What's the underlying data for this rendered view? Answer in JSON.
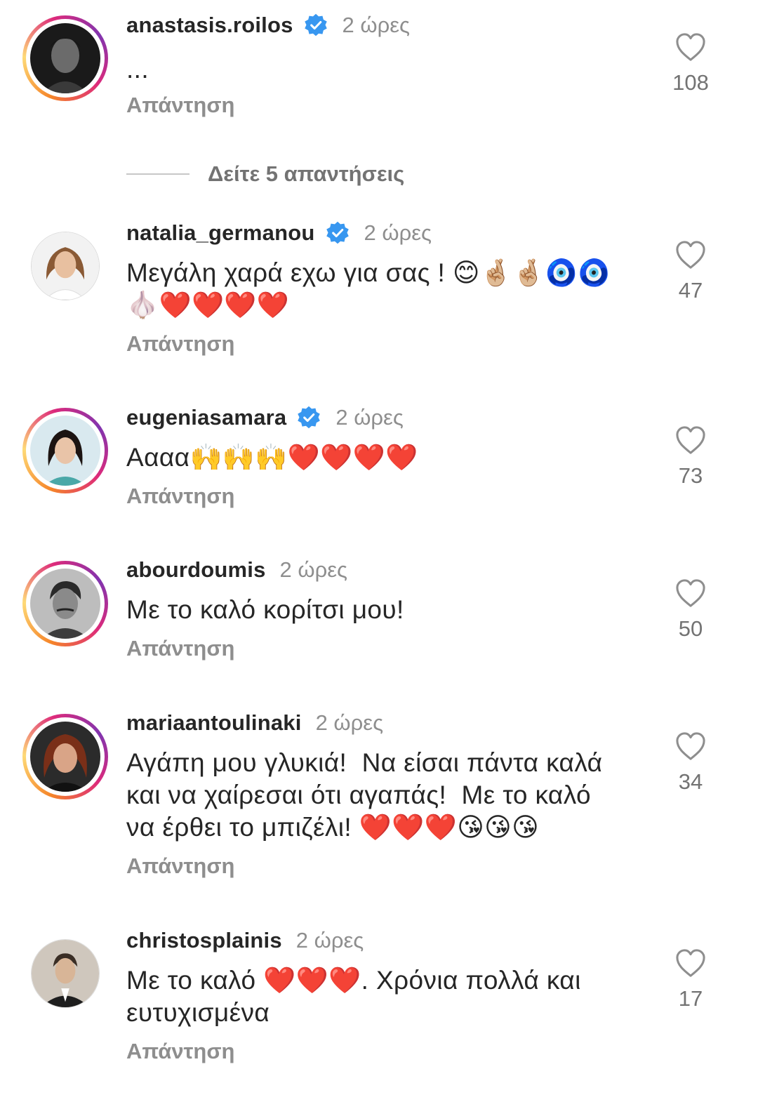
{
  "comments": [
    {
      "username": "anastasis.roilos",
      "verified": true,
      "time": "2 ώρες",
      "text": "...",
      "reply_label": "Απάντηση",
      "likes": "108",
      "avatar_ring": true
    },
    {
      "username": "natalia_germanou",
      "verified": true,
      "time": "2 ώρες",
      "text": "Μεγάλη χαρά εχω για σας ! 😊🤞🏼🤞🏼🧿🧿\n🧄❤️❤️❤️❤️",
      "reply_label": "Απάντηση",
      "likes": "47",
      "avatar_ring": false
    },
    {
      "username": "eugeniasamara",
      "verified": true,
      "time": "2 ώρες",
      "text": "Αααα🙌🙌🙌❤️❤️❤️❤️",
      "reply_label": "Απάντηση",
      "likes": "73",
      "avatar_ring": true
    },
    {
      "username": "abourdoumis",
      "verified": false,
      "time": "2 ώρες",
      "text": "Με το καλό κορίτσι μου!",
      "reply_label": "Απάντηση",
      "likes": "50",
      "avatar_ring": true
    },
    {
      "username": "mariaantoulinaki",
      "verified": false,
      "time": "2 ώρες",
      "text": "Αγάπη μου γλυκιά!  Να είσαι πάντα καλά\nκαι να χαίρεσαι ότι αγαπάς!  Με το καλό\nνα έρθει το μπιζέλι! ❤️❤️❤️😘😘😘",
      "reply_label": "Απάντηση",
      "likes": "34",
      "avatar_ring": true
    },
    {
      "username": "christosplainis",
      "verified": false,
      "time": "2 ώρες",
      "text": "Με το καλό ❤️❤️❤️. Χρόνια πολλά και\nευτυχισμένα",
      "reply_label": "Απάντηση",
      "likes": "17",
      "avatar_ring": false
    }
  ],
  "view_replies_label": "Δείτε 5 απαντήσεις",
  "colors": {
    "verified_blue": "#3897f0",
    "secondary_text": "#8e8e8e",
    "primary_text": "#262626"
  },
  "icons": {
    "like": "heart-outline-icon",
    "verified": "verified-badge-icon"
  }
}
